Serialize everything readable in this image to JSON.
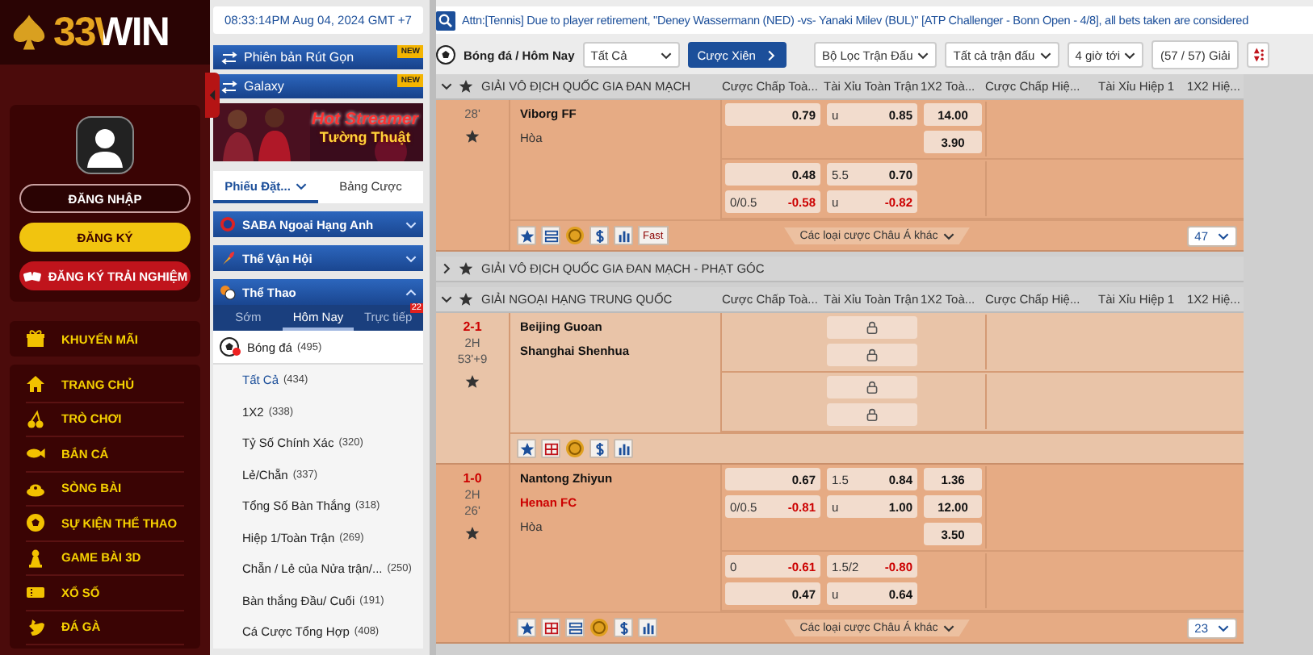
{
  "sidebar": {
    "logo": "33WIN",
    "buttons": [
      {
        "label": "ĐĂNG NHẬP",
        "kind": "outline"
      },
      {
        "label": "ĐĂNG KÝ",
        "kind": "primary"
      },
      {
        "label": "ĐĂNG KÝ TRẢI NGHIỆM",
        "kind": "trial"
      }
    ],
    "promo": {
      "label": "KHUYẾN MÃI",
      "kind": "gift"
    },
    "menu": [
      {
        "label": "TRANG CHỦ",
        "kind": "home"
      },
      {
        "label": "TRÒ CHƠI",
        "kind": "cherry"
      },
      {
        "label": "BẮN CÁ",
        "kind": "fish"
      },
      {
        "label": "SÒNG BÀI",
        "kind": "casino"
      },
      {
        "label": "SỰ KIỆN THỂ THAO",
        "kind": "ball"
      },
      {
        "label": "GAME BÀI 3D",
        "kind": "pawn"
      },
      {
        "label": "XỔ SỐ",
        "kind": "ticket"
      },
      {
        "label": "ĐÁ GÀ",
        "kind": "rooster"
      }
    ]
  },
  "center": {
    "clock": "08:33:14PM Aug 04, 2024 GMT +7",
    "banners": [
      {
        "label": "Phiên bản Rút Gọn",
        "badge": "NEW"
      },
      {
        "label": "Galaxy",
        "badge": "NEW"
      }
    ],
    "promo_banner": {
      "title": "Hot Streamer",
      "subtitle": "Tường Thuật"
    },
    "tabs": [
      {
        "label": "Phiếu Đặt...",
        "selected": true,
        "dropdown": true
      },
      {
        "label": "Bảng Cược",
        "selected": false,
        "dropdown": false
      }
    ],
    "sections": [
      {
        "label": "SABA Ngoại Hạng Anh",
        "kind": "emblem",
        "expanded": false
      },
      {
        "label": "Thế Vận Hội",
        "kind": "torch",
        "expanded": false
      },
      {
        "label": "Thể Thao",
        "kind": "balls",
        "expanded": true
      }
    ],
    "sport_tabs": [
      {
        "label": "Sớm",
        "selected": false
      },
      {
        "label": "Hôm Nay",
        "selected": true
      },
      {
        "label": "Trực tiếp",
        "selected": false,
        "badge": "22"
      }
    ],
    "sport": {
      "label": "Bóng đá",
      "count": "(495)"
    },
    "markets": [
      {
        "label": "Tất Cả",
        "count": "(434)",
        "selected": true
      },
      {
        "label": "1X2",
        "count": "(338)",
        "selected": false
      },
      {
        "label": "Tỷ Số Chính Xác",
        "count": "(320)",
        "selected": false
      },
      {
        "label": "Lẻ/Chẵn",
        "count": "(337)",
        "selected": false
      },
      {
        "label": "Tổng Số Bàn Thắng",
        "count": "(318)",
        "selected": false
      },
      {
        "label": "Hiệp 1/Toàn Trận",
        "count": "(269)",
        "selected": false
      },
      {
        "label": "Chẵn / Lẻ của Nửa trận/...",
        "count": "(250)",
        "selected": false
      },
      {
        "label": "Bàn thắng Đầu/ Cuối",
        "count": "(191)",
        "selected": false
      },
      {
        "label": "Cá Cược Tổng Hợp",
        "count": "(408)",
        "selected": false
      }
    ]
  },
  "marquee": "Attn:[Tennis] Due to player retirement, \"Deney Wassermann (NED) -vs- Yanaki Milev (BUL)\" [ATP Challenger - Bonn Open - 4/8], all bets taken are considered",
  "toolbar": {
    "title": "Bóng đá / Hôm Nay",
    "market_select": "Tất Cả",
    "parlay_button": "Cược Xiên",
    "filters": [
      "Bộ Lọc Trận Đấu",
      "Tất cả trận đấu",
      "4 giờ tới"
    ],
    "league_count": "(57 / 57) Giải"
  },
  "leagues": [
    {
      "name": "GIẢI VÔ ĐỊCH QUỐC GIA ĐAN MẠCH",
      "expanded": true,
      "columns": [
        "Cược Chấp Toà...",
        "Tài Xỉu Toàn Trận",
        "1X2 Toà...",
        "Cược Chấp Hiệ...",
        "Tài Xỉu Hiệp 1",
        "1X2 Hiệ..."
      ],
      "matches": [
        {
          "time": "28'",
          "color": "#e6ab84",
          "teams": [
            {
              "name": "Viborg FF",
              "highlight": false
            }
          ],
          "draw": "Hòa",
          "lines": [
            {
              "rows": [
                {
                  "hdp": {
                    "price": "0.79",
                    "negative": false
                  },
                  "ou": {
                    "line": "u",
                    "price": "0.85",
                    "negative": false
                  },
                  "x12": "14.00"
                },
                {
                  "x12": "3.90"
                }
              ]
            },
            {
              "rows": [
                {
                  "hdp": {
                    "price": "0.48",
                    "negative": false
                  },
                  "ou": {
                    "line": "5.5",
                    "price": "0.70",
                    "negative": false
                  }
                },
                {
                  "hdp": {
                    "line": "0/0.5",
                    "price": "-0.58",
                    "negative": true
                  },
                  "ou": {
                    "line": "u",
                    "price": "-0.82",
                    "negative": true
                  }
                }
              ]
            }
          ],
          "icons": [
            {
              "kind": "star"
            },
            {
              "kind": "list"
            },
            {
              "kind": "coin"
            },
            {
              "kind": "dollar"
            },
            {
              "kind": "stats"
            },
            {
              "kind": "fast",
              "label": "Fast"
            }
          ],
          "more": "Các loại cược Châu Á khác",
          "count": "47"
        }
      ]
    },
    {
      "name": "GIẢI VÔ ĐỊCH QUỐC GIA ĐAN MẠCH - PHẠT GÓC",
      "expanded": false
    },
    {
      "name": "GIẢI NGOẠI HẠNG TRUNG QUỐC",
      "expanded": true,
      "columns": [
        "Cược Chấp Toà...",
        "Tài Xỉu Toàn Trận",
        "1X2 Toà...",
        "Cược Chấp Hiệ...",
        "Tài Xỉu Hiệp 1",
        "1X2 Hiệ..."
      ],
      "matches": [
        {
          "score": "2-1",
          "period": "2H",
          "time": "53'+9",
          "color": "#e9c4a8",
          "teams": [
            {
              "name": "Beijing Guoan",
              "highlight": false
            },
            {
              "name": "Shanghai Shenhua",
              "highlight": false
            }
          ],
          "lines": [
            {
              "rows": [
                {
                  "ou": {
                    "locked": true
                  }
                },
                {
                  "ou": {
                    "locked": true
                  }
                }
              ]
            },
            {
              "rows": [
                {
                  "ou": {
                    "locked": true
                  }
                },
                {
                  "ou": {
                    "locked": true
                  }
                }
              ]
            }
          ],
          "icons": [
            {
              "kind": "star"
            },
            {
              "kind": "tv"
            },
            {
              "kind": "coin"
            },
            {
              "kind": "dollar"
            },
            {
              "kind": "stats"
            }
          ]
        },
        {
          "score": "1-0",
          "period": "2H",
          "time": "26'",
          "color": "#e6ab84",
          "teams": [
            {
              "name": "Nantong Zhiyun",
              "highlight": false
            },
            {
              "name": "Henan FC",
              "highlight": true
            }
          ],
          "draw": "Hòa",
          "lines": [
            {
              "rows": [
                {
                  "hdp": {
                    "price": "0.67",
                    "negative": false
                  },
                  "ou": {
                    "line": "1.5",
                    "price": "0.84",
                    "negative": false
                  },
                  "x12": "1.36"
                },
                {
                  "hdp": {
                    "line": "0/0.5",
                    "price": "-0.81",
                    "negative": true
                  },
                  "ou": {
                    "line": "u",
                    "price": "1.00",
                    "negative": false
                  },
                  "x12": "12.00"
                },
                {
                  "x12": "3.50"
                }
              ]
            },
            {
              "rows": [
                {
                  "hdp": {
                    "line": "0",
                    "price": "-0.61",
                    "negative": true
                  },
                  "ou": {
                    "line": "1.5/2",
                    "price": "-0.80",
                    "negative": true
                  }
                },
                {
                  "hdp": {
                    "price": "0.47",
                    "negative": false
                  },
                  "ou": {
                    "line": "u",
                    "price": "0.64",
                    "negative": false
                  }
                }
              ]
            }
          ],
          "icons": [
            {
              "kind": "star"
            },
            {
              "kind": "tv"
            },
            {
              "kind": "list"
            },
            {
              "kind": "coin"
            },
            {
              "kind": "dollar"
            },
            {
              "kind": "stats"
            }
          ],
          "more": "Các loại cược Châu Á khác",
          "count": "23"
        }
      ]
    }
  ]
}
